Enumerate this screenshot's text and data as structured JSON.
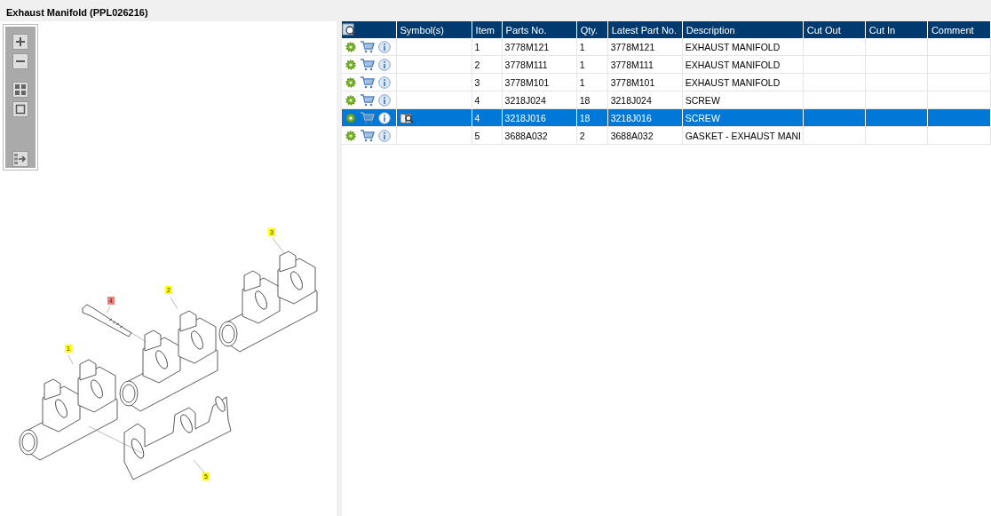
{
  "title": "Exhaust Manifold (PPL026216)",
  "callouts": [
    {
      "label": "3",
      "selected": false
    },
    {
      "label": "2",
      "selected": false
    },
    {
      "label": "4",
      "selected": true
    },
    {
      "label": "1",
      "selected": false
    },
    {
      "label": "5",
      "selected": false
    }
  ],
  "table": {
    "columns": [
      "Symbol(s)",
      "Item",
      "Parts No.",
      "Qty.",
      "Latest Part No.",
      "Description",
      "Cut Out",
      "Cut In",
      "Comment"
    ],
    "rows": [
      {
        "selected": false,
        "symbol": false,
        "cells": [
          "",
          "1",
          "3778M121",
          "1",
          "3778M121",
          "EXHAUST MANIFOLD",
          "",
          "",
          ""
        ]
      },
      {
        "selected": false,
        "symbol": false,
        "cells": [
          "",
          "2",
          "3778M111",
          "1",
          "3778M111",
          "EXHAUST MANIFOLD",
          "",
          "",
          ""
        ]
      },
      {
        "selected": false,
        "symbol": false,
        "cells": [
          "",
          "3",
          "3778M101",
          "1",
          "3778M101",
          "EXHAUST MANIFOLD",
          "",
          "",
          ""
        ]
      },
      {
        "selected": false,
        "symbol": false,
        "cells": [
          "",
          "4",
          "3218J024",
          "18",
          "3218J024",
          "SCREW",
          "",
          "",
          ""
        ]
      },
      {
        "selected": true,
        "symbol": true,
        "cells": [
          "",
          "4",
          "3218J016",
          "18",
          "3218J016",
          "SCREW",
          "",
          "",
          ""
        ]
      },
      {
        "selected": false,
        "symbol": false,
        "cells": [
          "",
          "5",
          "3688A032",
          "2",
          "3688A032",
          "GASKET - EXHAUST MANI",
          "",
          "",
          ""
        ]
      }
    ]
  }
}
